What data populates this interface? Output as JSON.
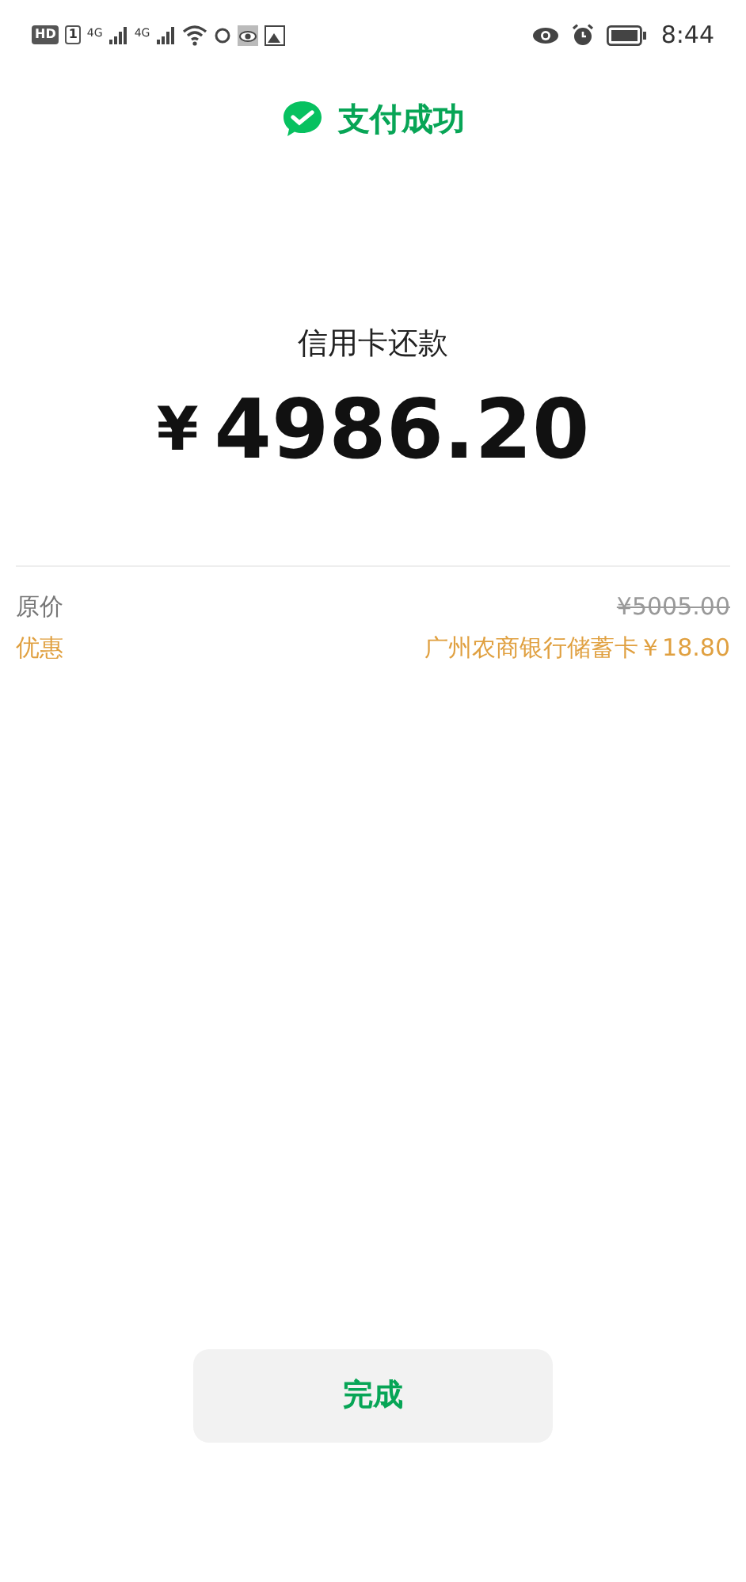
{
  "status_bar": {
    "hd": "HD",
    "sim": "1",
    "network_1": "4G",
    "network_2": "4G",
    "time": "8:44"
  },
  "header": {
    "title": "支付成功"
  },
  "payment": {
    "label": "信用卡还款",
    "currency": "¥",
    "amount": "4986.20"
  },
  "details": [
    {
      "kind": "original",
      "label": "原价",
      "value": "¥5005.00"
    },
    {
      "kind": "discount",
      "label": "优惠",
      "value": "广州农商银行储蓄卡￥18.80"
    }
  ],
  "done_button": {
    "label": "完成"
  }
}
